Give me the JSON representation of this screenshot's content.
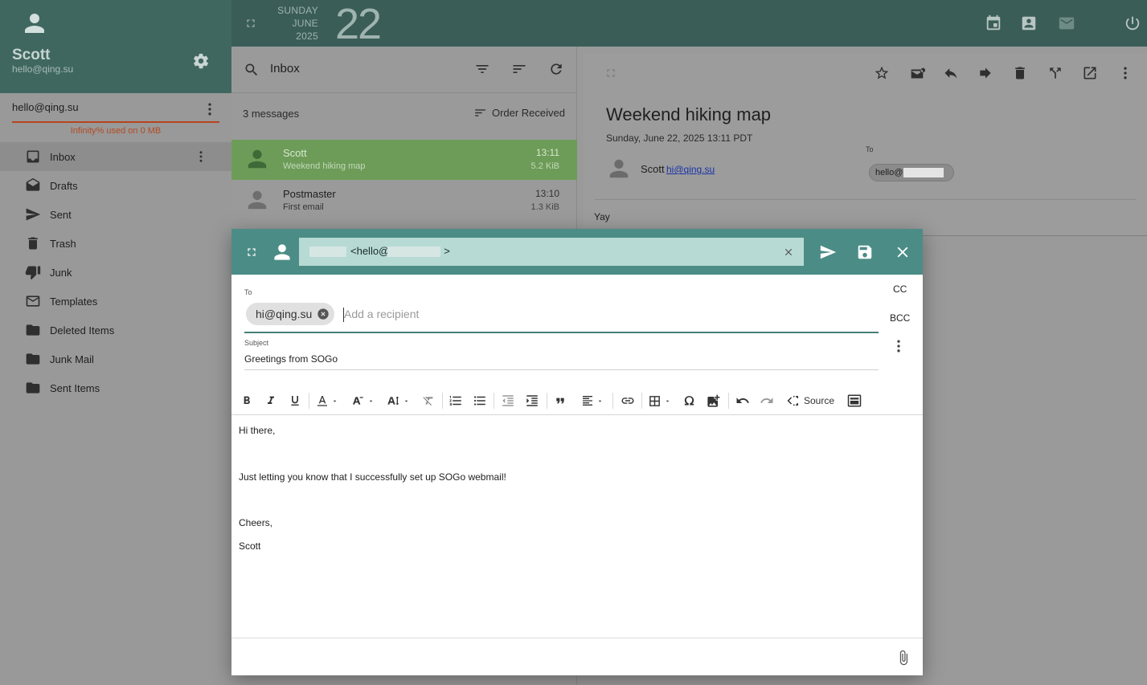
{
  "sidebar": {
    "user_name": "Scott",
    "user_email": "hello@qing.su",
    "account": "hello@qing.su",
    "quota": "Infinity% used on 0 MB",
    "folders": [
      {
        "label": "Inbox",
        "icon": "inbox-icon"
      },
      {
        "label": "Drafts",
        "icon": "drafts-icon"
      },
      {
        "label": "Sent",
        "icon": "send-icon"
      },
      {
        "label": "Trash",
        "icon": "trash-icon"
      },
      {
        "label": "Junk",
        "icon": "thumb-down-icon"
      },
      {
        "label": "Templates",
        "icon": "mail-icon"
      },
      {
        "label": "Deleted Items",
        "icon": "folder-icon"
      },
      {
        "label": "Junk Mail",
        "icon": "folder-icon"
      },
      {
        "label": "Sent Items",
        "icon": "folder-icon"
      }
    ]
  },
  "topbar": {
    "weekday": "SUNDAY",
    "month": "JUNE",
    "year": "2025",
    "day": "22",
    "icons": [
      "calendar-icon",
      "contacts-icon",
      "mail-icon",
      "power-icon"
    ]
  },
  "list": {
    "mailbox": "Inbox",
    "count": "3 messages",
    "order": "Order Received",
    "messages": [
      {
        "sender": "Scott",
        "subject": "Weekend hiking map",
        "time": "13:11",
        "size": "5.2 KiB",
        "selected": true
      },
      {
        "sender": "Postmaster",
        "subject": "First email",
        "time": "13:10",
        "size": "1.3 KiB",
        "selected": false
      }
    ]
  },
  "viewer": {
    "subject": "Weekend hiking map",
    "date": "Sunday, June 22, 2025 13:11 PDT",
    "from_name": "Scott",
    "from_email": "hi@qing.su",
    "to_label": "To",
    "to_chip": "hello@",
    "body": "Yay"
  },
  "compose": {
    "from_prefix": "<hello@",
    "from_suffix": ">",
    "to_label": "To",
    "to_chip": "hi@qing.su",
    "to_placeholder": "Add a recipient",
    "cc": "CC",
    "bcc": "BCC",
    "subject_label": "Subject",
    "subject": "Greetings from SOGo",
    "source_label": "Source",
    "body_lines": [
      "Hi there,",
      "Just letting you know that I successfully set up SOGo webmail!",
      "Cheers,",
      "Scott"
    ]
  },
  "colors": {
    "sidebar_header": "#3f6760",
    "topbar": "#3b5d58",
    "compose_header": "#4b8d86",
    "selected_row": "#6d9c59",
    "quota_text": "#b34b22"
  }
}
